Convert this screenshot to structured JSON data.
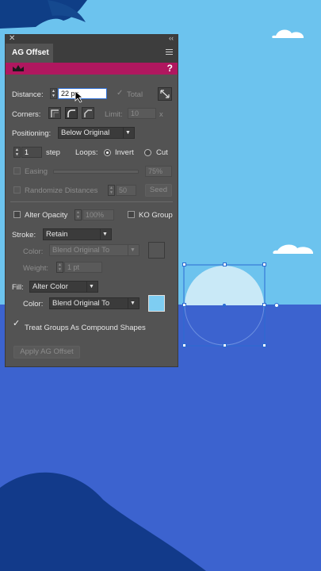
{
  "panel": {
    "title": "AG Offset",
    "help_label": "?",
    "distance": {
      "label": "Distance:",
      "value": "22 px",
      "total_label": "Total"
    },
    "corners": {
      "label": "Corners:",
      "limit_label": "Limit:",
      "limit_value": "10",
      "limit_unit": "x"
    },
    "positioning": {
      "label": "Positioning:",
      "value": "Below Original"
    },
    "steps": {
      "value": "1",
      "step_label": "step",
      "loops_label": "Loops:",
      "invert_label": "Invert",
      "cut_label": "Cut"
    },
    "easing": {
      "label": "Easing",
      "value": "75%"
    },
    "randomize": {
      "label": "Randomize Distances",
      "value": "50",
      "seed_label": "Seed"
    },
    "opacity": {
      "label": "Alter Opacity",
      "value": "100%",
      "ko_label": "KO Group"
    },
    "stroke": {
      "label": "Stroke:",
      "value": "Retain",
      "color_label": "Color:",
      "color_value": "Blend Original To",
      "weight_label": "Weight:",
      "weight_value": "1 pt"
    },
    "fill": {
      "label": "Fill:",
      "value": "Alter Color",
      "color_label": "Color:",
      "color_value": "Blend Original To"
    },
    "compound": {
      "label": "Treat Groups As Compound Shapes"
    },
    "apply_label": "Apply AG Offset"
  },
  "colors": {
    "sky": "#6cc3ee",
    "sea": "#3c63cf",
    "accent_banner": "#b0175f",
    "fill_swatch": "#7ecdf2",
    "sun": "#c9e9f7"
  }
}
